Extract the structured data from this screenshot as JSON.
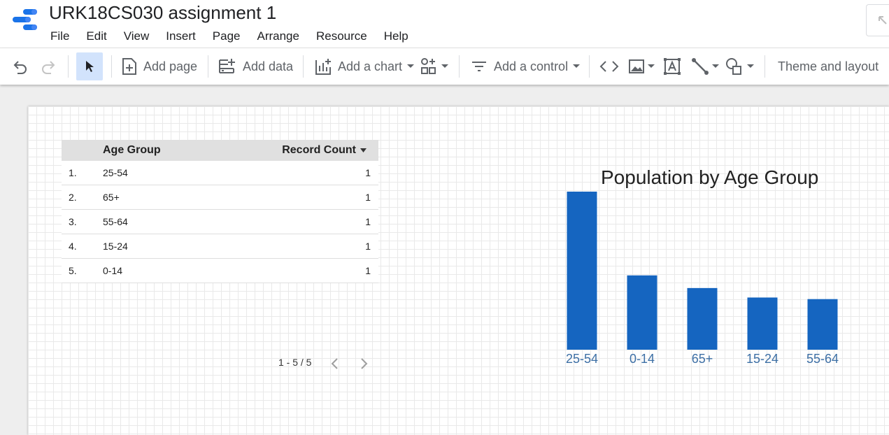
{
  "app": {
    "title": "URK18CS030 assignment 1"
  },
  "menu": [
    "File",
    "Edit",
    "View",
    "Insert",
    "Page",
    "Arrange",
    "Resource",
    "Help"
  ],
  "toolbar": {
    "add_page": "Add page",
    "add_data": "Add data",
    "add_chart": "Add a chart",
    "add_control": "Add a control",
    "theme_layout": "Theme and layout"
  },
  "table": {
    "headers": {
      "age": "Age Group",
      "count": "Record Count"
    },
    "rows": [
      {
        "idx": "1.",
        "age": "25-54",
        "count": "1"
      },
      {
        "idx": "2.",
        "age": "65+",
        "count": "1"
      },
      {
        "idx": "3.",
        "age": "55-64",
        "count": "1"
      },
      {
        "idx": "4.",
        "age": "15-24",
        "count": "1"
      },
      {
        "idx": "5.",
        "age": "0-14",
        "count": "1"
      }
    ],
    "pagination": "1 - 5 / 5"
  },
  "chart_data": {
    "type": "bar",
    "title": "Population by Age Group",
    "categories": [
      "25-54",
      "0-14",
      "65+",
      "15-24",
      "55-64"
    ],
    "values": [
      100,
      47,
      39,
      33,
      32
    ],
    "bar_color": "#1565c0",
    "label_color": "#3d6fa5",
    "grid": false
  },
  "colors": {
    "accent": "#1a73e8",
    "selected_tool": "#d2e3fc"
  }
}
